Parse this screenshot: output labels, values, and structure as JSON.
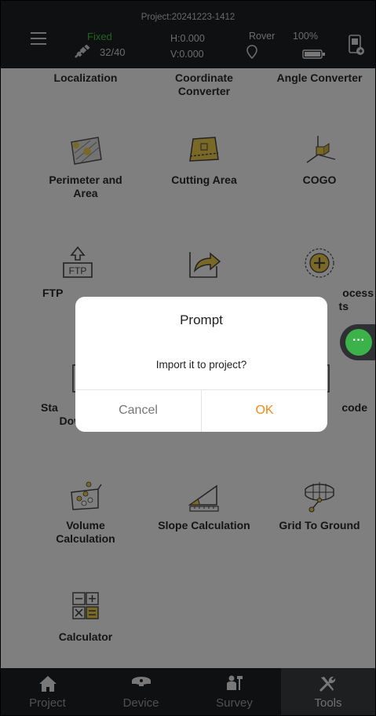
{
  "status_bar": {
    "project": "Project:20241223-1412",
    "fix_status": "Fixed",
    "satellites": "32/40",
    "h_value": "H:0.000",
    "v_value": "V:0.000",
    "mode": "Rover",
    "battery": "100%"
  },
  "tools": {
    "localization": "Localization",
    "coord_line1": "Coordinate",
    "coord_line2": "Converter",
    "angle": "Angle Converter",
    "perim_line1": "Perimeter and",
    "perim_line2": "Area",
    "cutting": "Cutting Area",
    "cogo": "COGO",
    "ftp": "FTP",
    "process_line1": "ocess",
    "process_line2": "ts",
    "static_line1": "Sta",
    "static_line2": "Download",
    "code": "code",
    "volume_line1": "Volume",
    "volume_line2": "Calculation",
    "slope": "Slope Calculation",
    "grid": "Grid To Ground",
    "calculator": "Calculator"
  },
  "dialog": {
    "title": "Prompt",
    "message": "Import it to project?",
    "cancel": "Cancel",
    "ok": "OK"
  },
  "bottom_nav": {
    "project": "Project",
    "device": "Device",
    "survey": "Survey",
    "tools": "Tools"
  },
  "colors": {
    "accent": "#f28a1a",
    "fixed": "#3fbf3f",
    "float_button": "#3cb34a"
  }
}
